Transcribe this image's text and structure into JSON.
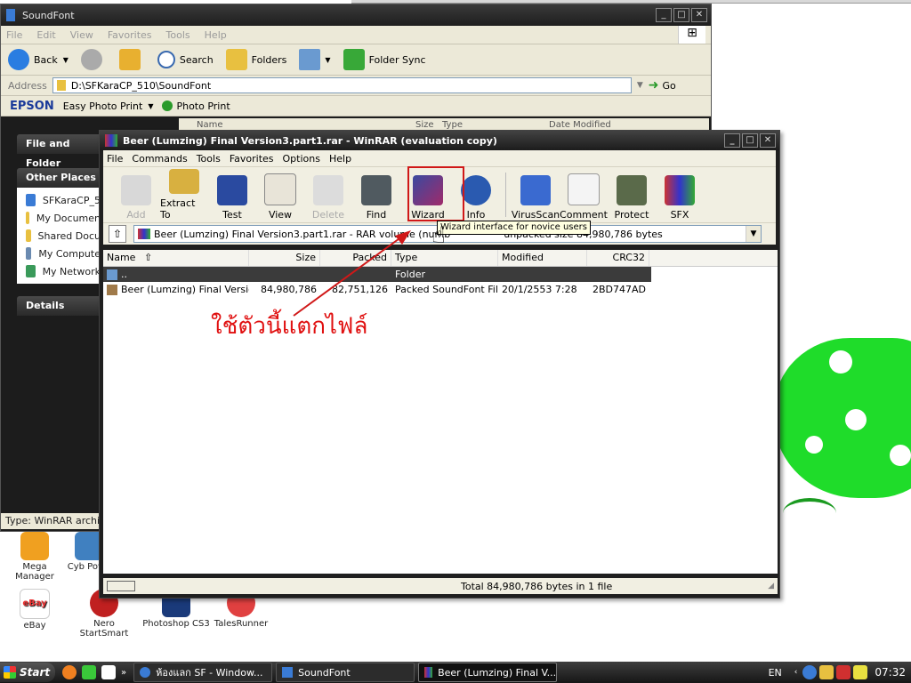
{
  "colors": {
    "accent_red": "#d01818",
    "dark_chrome": "#1f1f1f",
    "selection": "#3b3b3b",
    "mushroom_green": "#1fdc2a"
  },
  "explorer": {
    "title": "SoundFont",
    "menu": [
      "File",
      "Edit",
      "View",
      "Favorites",
      "Tools",
      "Help"
    ],
    "toolbar": {
      "back": "Back",
      "search": "Search",
      "folders": "Folders",
      "folder_sync": "Folder Sync"
    },
    "address_label": "Address",
    "address_value": "D:\\SFKaraCP_510\\SoundFont",
    "go_label": "Go",
    "epson": {
      "logo": "EPSON",
      "easy_photo_print": "Easy Photo Print",
      "photo_print": "Photo Print"
    },
    "file_and_folder_label": "File and Folder",
    "other_places_label": "Other Places",
    "other_places": [
      "SFKaraCP_5",
      "My Documen",
      "Shared Docu",
      "My Compute",
      "My Network"
    ],
    "details_label": "Details",
    "header_name": "Name",
    "header_size": "Size",
    "header_type": "Type",
    "header_modified": "Date Modified",
    "status": "Type: WinRAR archive"
  },
  "winrar": {
    "title": "Beer (Lumzing) Final Version3.part1.rar - WinRAR (evaluation copy)",
    "menu": [
      "File",
      "Commands",
      "Tools",
      "Favorites",
      "Options",
      "Help"
    ],
    "toolbar": [
      {
        "label": "Add",
        "icon": "add-icon",
        "disabled": true
      },
      {
        "label": "Extract To",
        "icon": "extract-icon",
        "disabled": false
      },
      {
        "label": "Test",
        "icon": "test-icon",
        "disabled": false
      },
      {
        "label": "View",
        "icon": "view-icon",
        "disabled": false
      },
      {
        "label": "Delete",
        "icon": "delete-icon",
        "disabled": true
      },
      {
        "label": "Find",
        "icon": "find-icon",
        "disabled": false
      },
      {
        "label": "Wizard",
        "icon": "wizard-icon",
        "disabled": false
      },
      {
        "label": "Info",
        "icon": "info-icon",
        "disabled": false
      },
      {
        "label": "VirusScan",
        "icon": "virusscan-icon",
        "disabled": false
      },
      {
        "label": "Comment",
        "icon": "comment-icon",
        "disabled": false
      },
      {
        "label": "Protect",
        "icon": "protect-icon",
        "disabled": false
      },
      {
        "label": "SFX",
        "icon": "sfx-icon",
        "disabled": false
      }
    ],
    "path_text": "Beer (Lumzing) Final Version3.part1.rar - RAR volume (numb",
    "path_text_tail": "unpacked size 84,980,786 bytes",
    "tooltip": "Wizard interface for novice users",
    "columns": [
      "Name",
      "Size",
      "Packed",
      "Type",
      "Modified",
      "CRC32"
    ],
    "rows": [
      {
        "name": "..",
        "size": "",
        "packed": "",
        "type": "Folder",
        "modified": "",
        "crc": ""
      },
      {
        "name": "Beer (Lumzing) Final Versio...",
        "size": "84,980,786",
        "packed": "82,751,126",
        "type": "Packed SoundFont File",
        "modified": "20/1/2553 7:28",
        "crc": "2BD747AD"
      }
    ],
    "status_total": "Total 84,980,786 bytes in 1 file"
  },
  "annotation": {
    "text": "ใช้ตัวนี้แตกไฟล์"
  },
  "desktop_icons": [
    {
      "label": "Mega Manager",
      "icon": "mega-manager-icon"
    },
    {
      "label": "Cyb Powe",
      "icon": "cyberlink-icon"
    },
    {
      "label": "eBay",
      "icon": "ebay-icon"
    },
    {
      "label": "Nero StartSmart",
      "icon": "nero-icon"
    },
    {
      "label": "Photoshop CS3",
      "icon": "photoshop-icon"
    },
    {
      "label": "TalesRunner",
      "icon": "talesrunner-icon"
    }
  ],
  "taskbar": {
    "start": "Start",
    "tasks": [
      "ห้องแลก SF - Window...",
      "SoundFont",
      "Beer (Lumzing) Final V..."
    ],
    "lang": "EN",
    "clock": "07:32"
  }
}
